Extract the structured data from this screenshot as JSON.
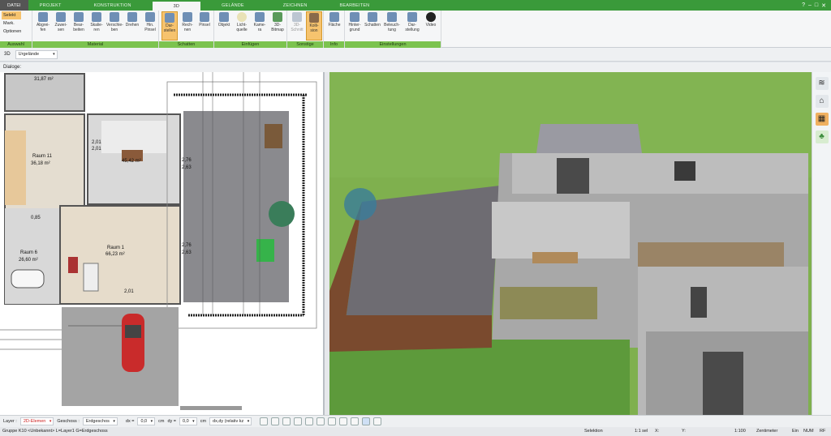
{
  "tabs": [
    "DATEI",
    "PROJEKT",
    "KONSTRUKTION",
    "3D",
    "GELÄNDE",
    "ZEICHNEN",
    "BEARBEITEN"
  ],
  "window_controls": [
    "?",
    "–",
    "□",
    "✕"
  ],
  "select": {
    "items": [
      "Selekt",
      "Mark.",
      "Optionen"
    ]
  },
  "groups": [
    "Auswahl",
    "Material",
    "Schatten",
    "Einfügen",
    "Sonstige",
    "Info",
    "Einstellungen"
  ],
  "buttons": {
    "abgreifen": "Abgrei- fen",
    "zuweisen": "Zuwei- sen",
    "bearbeiten": "Bear- beiten",
    "skalieren": "Skalie- ren",
    "verschieben": "Verschie- ben",
    "drehen": "Drehen",
    "hinpinsel": "Hin. Pinsel",
    "darstellen": "Dar- stellen",
    "rechnen": "Rech- nen",
    "pinsel": "Pinsel",
    "objekt": "Objekt",
    "lichtquelle": "Licht- quelle",
    "kamera": "Kame- ra",
    "bitmap3d": "3D- Bitmap",
    "schnitt3d": "3D- Schnitt",
    "kollision": "Kolli- sion",
    "flaeche": "Fläche",
    "hintergrund": "Hinter- grund",
    "schatten2": "Schatten",
    "beleuchtung": "Beleuch- tung",
    "darstellung": "Dar- stellung",
    "video": "Video"
  },
  "toolbar2": {
    "mode": "3D",
    "terrain": "Urgelände"
  },
  "dialog_label": "Dialoge:",
  "plan": {
    "rooms": [
      {
        "name": "",
        "area": "31,87 m²"
      },
      {
        "name": "Raum 11",
        "area": "36,18 m²"
      },
      {
        "name": "",
        "area": "45,42 m²"
      },
      {
        "name": "Raum 6",
        "area": "26,60 m²"
      },
      {
        "name": "Raum 1",
        "area": "66,23 m²"
      }
    ],
    "dims": [
      "2,76",
      "2,63",
      "2,76",
      "2,63",
      "2,01",
      "2,01",
      "0,85",
      "2,01"
    ]
  },
  "status": {
    "layer_label": "Layer :",
    "layer_value": "2D-Elemen",
    "geschoss_label": "Geschoss :",
    "geschoss_value": "Erdgeschos",
    "dx_label": "dx =",
    "dx_value": "0,0",
    "dx_unit": "cm",
    "dy_label": "dy =",
    "dy_value": "0,0",
    "dy_unit": "cm",
    "relative": "dx,dy (relativ kz"
  },
  "statusbar": {
    "group": "Gruppe K10 <Unbekannt> L=Layer1 G=Erdgeschoss",
    "selektion": "Selektion",
    "scale": "1:1 sel",
    "x": "X:",
    "y": "Y:",
    "zoom": "1:100",
    "unit": "Zentimeter",
    "ein": "Ein",
    "num": "NUM",
    "rf": "RF"
  },
  "colors": {
    "accent": "#3a9a3a",
    "ribbon_group": "#7cc34f",
    "active": "#f6c36e"
  }
}
